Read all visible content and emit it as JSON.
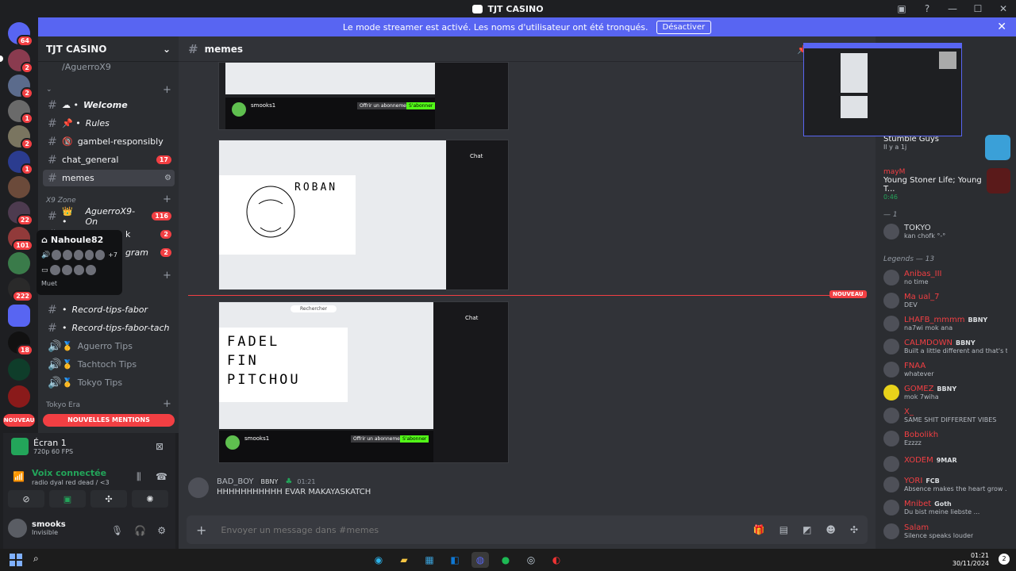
{
  "titlebar": {
    "title": "TJT CASINO"
  },
  "banner": {
    "text": "Le mode streamer est activé. Les noms d'utilisateur ont été tronqués.",
    "button": "Désactiver"
  },
  "servers": [
    {
      "badge": "64"
    },
    {
      "badge": "2"
    },
    {
      "badge": "2"
    },
    {
      "badge": "1"
    },
    {
      "badge": "2"
    },
    {
      "badge": "1"
    },
    {
      "badge": ""
    },
    {
      "badge": "22"
    },
    {
      "badge": "101"
    },
    {
      "badge": ""
    },
    {
      "badge": "222"
    },
    {
      "badge": ""
    },
    {
      "badge": "18"
    },
    {
      "badge": ""
    },
    {
      "badge": ""
    }
  ],
  "guild": {
    "name": "TJT CASINO"
  },
  "channels": {
    "top_partial": "/AguerroX9",
    "items": [
      {
        "label": "Welcome",
        "prefix": "☁ •",
        "count": ""
      },
      {
        "label": "Rules",
        "prefix": "📌 •",
        "count": ""
      },
      {
        "label": "gambel-responsibly",
        "prefix": "🔞",
        "count": ""
      },
      {
        "label": "chat_general",
        "prefix": "",
        "count": "17"
      },
      {
        "label": "memes",
        "prefix": "",
        "count": ""
      }
    ],
    "cat_x9": "X9 Zone",
    "items2": [
      {
        "label": "AguerroX9-On",
        "prefix": "👑 •",
        "count": "116"
      },
      {
        "label": "k",
        "prefix": "",
        "count": "2"
      },
      {
        "label": "gram",
        "prefix": "",
        "count": "2"
      },
      {
        "label": "Record-tips-fabor",
        "prefix": "•",
        "count": ""
      },
      {
        "label": "Record-tips-fabor-tach",
        "prefix": "•",
        "count": ""
      }
    ],
    "voice": [
      {
        "label": "Aguerro Tips"
      },
      {
        "label": "Tachtoch Tips"
      },
      {
        "label": "Tokyo Tips"
      }
    ],
    "cat_tokyo": "Tokyo Era",
    "new_mentions": "NOUVELLES MENTIONS",
    "new_tag": "NOUVEAU"
  },
  "tooltip": {
    "name": "Nahoule82",
    "more": "+7",
    "muted": "Muet"
  },
  "voice_panel": {
    "screen": "Écran 1",
    "screen_sub": "720p 60 FPS",
    "connected": "Voix connectée",
    "channel": "radio dyal red dead / <3",
    "user": "smooks",
    "status": "Invisible"
  },
  "main": {
    "channel": "memes",
    "new_tag": "NOUVEAU",
    "message": {
      "author": "BAD_BOY",
      "badge": "BBNY",
      "time": "01:21",
      "text": "HHHHHHHHHHH EVAR MAKAYASKATCH"
    },
    "composer_placeholder": "Envoyer un message dans #memes",
    "img1": {
      "channel": "smooks1",
      "sub": "Offrir un abonnement",
      "follow": "S'abonner"
    },
    "img2": {
      "drawing": "ROBAN",
      "chat": "Chat"
    },
    "img3": {
      "drawing": "FADEL\nFIN\nPITCHOU",
      "channel": "smooks1",
      "sub": "Offrir un abonnement",
      "follow": "S'abonner",
      "chat": "Chat",
      "search": "Rechercher"
    }
  },
  "members": {
    "games": [
      {
        "title": "Stumble Guys",
        "sub": "Il y a 1j"
      },
      {
        "title": "Young Stoner Life; Young T...",
        "sub": "0:46",
        "name": "mayM"
      }
    ],
    "cat1": "— 1",
    "tokyo": {
      "name": "TOKYO",
      "activity": "kan chofk °-°"
    },
    "cat2": "Legends — 13",
    "list": [
      {
        "name": "Anibas_III",
        "activity": "no time",
        "badge": ""
      },
      {
        "name": "Ma ual_7",
        "activity": "DEV",
        "badge": ""
      },
      {
        "name": "LHAFB_mmmm",
        "activity": "na7wi mok ana",
        "badge": "BBNY"
      },
      {
        "name": "CALMDOWN",
        "activity": "Built a little different and that's the...",
        "badge": "BBNY"
      },
      {
        "name": "FNAA",
        "activity": "whatever",
        "badge": ""
      },
      {
        "name": "GOMEZ",
        "activity": "mok 7wiha",
        "badge": "BBNY"
      },
      {
        "name": "X_",
        "activity": "SAME SHIT DIFFERENT VIBES",
        "badge": ""
      },
      {
        "name": "Bobolikh",
        "activity": "Ezzzz",
        "badge": ""
      },
      {
        "name": "XODEM",
        "activity": "",
        "badge": "9MAR"
      },
      {
        "name": "YORI",
        "activity": "Absence makes the heart grow ...",
        "badge": "FCB"
      },
      {
        "name": "Mnibet",
        "activity": "Du bist meine liebste ...",
        "badge": "Goth"
      },
      {
        "name": "Salam",
        "activity": "Silence speaks louder",
        "badge": ""
      }
    ]
  },
  "taskbar": {
    "time": "01:21",
    "date": "30/11/2024",
    "notif": "2"
  }
}
